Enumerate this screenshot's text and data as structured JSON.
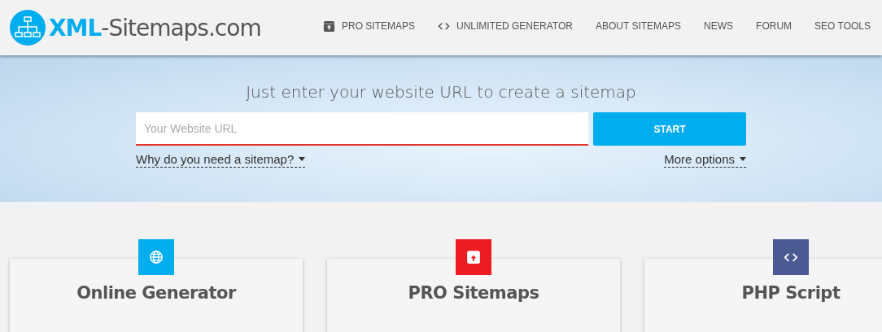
{
  "logo": {
    "accent": "XML",
    "rest": "-Sitemaps.com"
  },
  "nav": [
    {
      "label": "PRO SITEMAPS",
      "kind": "archive"
    },
    {
      "label": "UNLIMITED GENERATOR",
      "kind": "code"
    },
    {
      "label": "ABOUT SITEMAPS"
    },
    {
      "label": "NEWS"
    },
    {
      "label": "FORUM"
    },
    {
      "label": "SEO TOOLS"
    }
  ],
  "hero": {
    "title": "Just enter your website URL to create a sitemap",
    "url_field": {
      "placeholder": "Your Website URL"
    },
    "start_button": "START",
    "links": [
      "Why do you need a sitemap?",
      "More options"
    ]
  },
  "cards": [
    {
      "title": "Online Generator",
      "kind": "globe",
      "color": "#00adef"
    },
    {
      "title": "PRO Sitemaps",
      "kind": "archive",
      "color": "#ed1c24"
    },
    {
      "title": "PHP Script",
      "kind": "code",
      "color": "#4c5a94"
    }
  ]
}
